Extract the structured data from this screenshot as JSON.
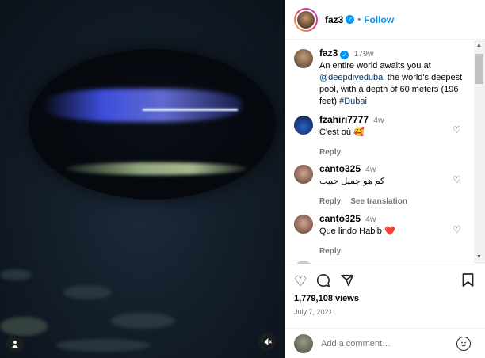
{
  "header": {
    "username": "faz3",
    "follow_label": "Follow"
  },
  "caption": {
    "username": "faz3",
    "time": "179w",
    "text_before": "An entire world awaits you at ",
    "mention": "@deepdivedubai",
    "text_after": " the world's deepest pool, with a depth of 60 meters (196 feet) ",
    "hashtag": "#Dubai"
  },
  "comments": [
    {
      "username": "fzahiri7777",
      "time": "4w",
      "text": "C'est où 🥰",
      "reply": "Reply",
      "see_translation": ""
    },
    {
      "username": "canto325",
      "time": "4w",
      "text": "كم هو جميل حبيب",
      "reply": "Reply",
      "see_translation": "See translation"
    },
    {
      "username": "canto325",
      "time": "4w",
      "text": "Que lindo Habib ❤️",
      "reply": "Reply",
      "see_translation": ""
    }
  ],
  "stats": {
    "views": "1,779,108 views",
    "date": "July 7, 2021"
  },
  "add_comment": {
    "placeholder": "Add a comment…"
  },
  "icons": {
    "like": "heart-icon",
    "comment": "comment-icon",
    "share": "share-icon",
    "save": "bookmark-icon",
    "mute": "mute-icon",
    "tagged_user": "user-icon",
    "emoji": "emoji-icon"
  },
  "colors": {
    "accent": "#0095f6",
    "verified": "#0095f6",
    "heart_red": "#e0245e"
  }
}
